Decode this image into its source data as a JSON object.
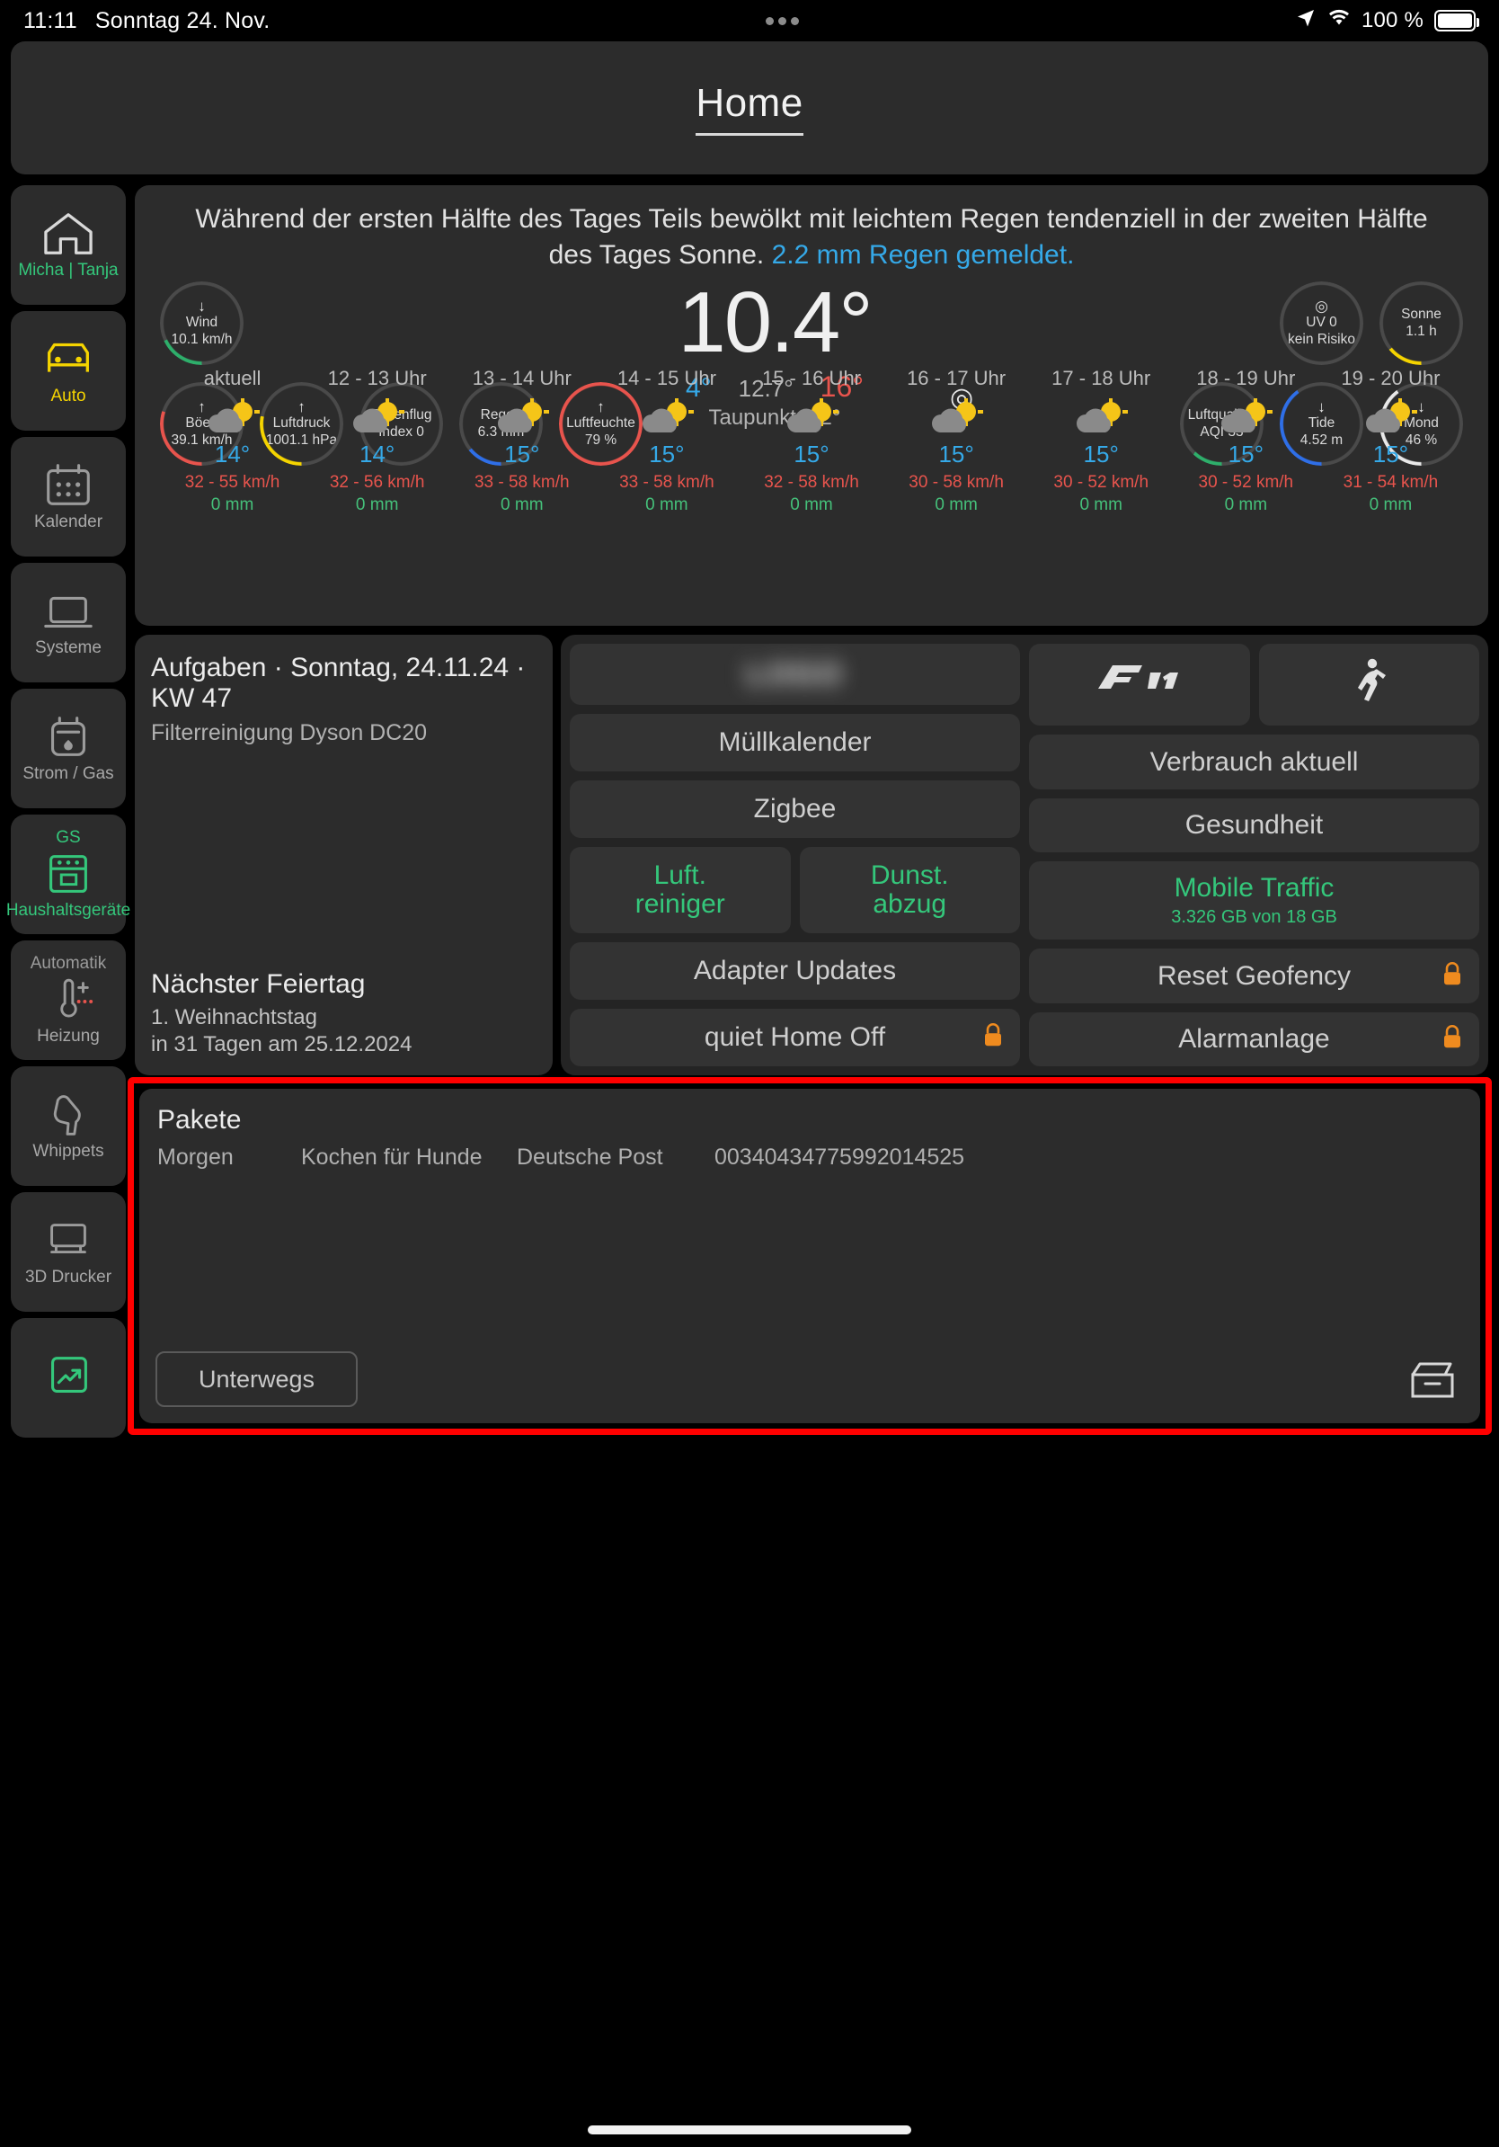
{
  "statusbar": {
    "time": "11:11",
    "date": "Sonntag 24. Nov.",
    "battery_percent": "100 %",
    "location_icon": "location-arrow-icon",
    "wifi_icon": "wifi-icon"
  },
  "header": {
    "title": "Home"
  },
  "sidebar": {
    "items": [
      {
        "label": "Micha | Tanja",
        "icon": "house-icon",
        "state": "green",
        "top": ""
      },
      {
        "label": "Auto",
        "icon": "car-icon",
        "state": "yellow",
        "top": ""
      },
      {
        "label": "Kalender",
        "icon": "calendar-icon",
        "state": "grey",
        "top": ""
      },
      {
        "label": "Systeme",
        "icon": "laptop-icon",
        "state": "grey",
        "top": ""
      },
      {
        "label": "Strom / Gas",
        "icon": "meter-icon",
        "state": "grey",
        "top": ""
      },
      {
        "label": "Haushaltsgeräte",
        "icon": "dishwasher-icon",
        "state": "green",
        "top": "GS"
      },
      {
        "label": "Heizung",
        "icon": "thermostat-icon",
        "state": "grey",
        "top": "Automatik"
      },
      {
        "label": "Whippets",
        "icon": "dog-icon",
        "state": "grey",
        "top": ""
      },
      {
        "label": "3D Drucker",
        "icon": "printer-icon",
        "state": "grey",
        "top": ""
      },
      {
        "label": "",
        "icon": "trend-chart-icon",
        "state": "green",
        "top": ""
      }
    ]
  },
  "weather": {
    "summary_prefix": "Während der ersten Hälfte des Tages Teils bewölkt mit leichtem Regen tendenziell in der zweiten Hälfte des Tages Sonne. ",
    "summary_rain": "2.2 mm Regen gemeldet.",
    "temperature": "10.4°",
    "temp_min": "4°",
    "temp_feels": "12.7°",
    "temp_max": "16°",
    "dewpoint": "Taupunkt 9.2°",
    "target_icon": "target-icon",
    "gauges": [
      {
        "name": "Wind",
        "value": "10.1 km/h",
        "arrow": "↓",
        "color": "#2eaf6b",
        "pct": 18
      },
      {
        "name": "Böen",
        "value": "39.1 km/h",
        "arrow": "↑",
        "color": "#e8544d",
        "pct": 30
      },
      {
        "name": "Luftdruck",
        "value": "1001.1 hPa",
        "arrow": "↑",
        "color": "#f5d400",
        "pct": 28
      },
      {
        "name": "Pollenflug",
        "value": "Index 0",
        "arrow": "",
        "color": "#4a4a4a",
        "pct": 0
      },
      {
        "name": "Regen",
        "value": "6.3 mm",
        "arrow": "",
        "color": "#2f6fe8",
        "pct": 14
      },
      {
        "name": "Luftfeuchte",
        "value": "79 %",
        "arrow": "↑",
        "color": "#e8544d",
        "pct": 79
      },
      {
        "name": "UV 0",
        "value": "kein Risiko",
        "arrow": "",
        "icon": "uv-target-icon",
        "color": "#4a4a4a",
        "pct": 0
      },
      {
        "name": "Sonne",
        "value": "1.1 h",
        "arrow": "",
        "color": "#f5d400",
        "pct": 14
      },
      {
        "name": "Luftqualität",
        "value": "AQI 33",
        "arrow": "",
        "color": "#2eaf6b",
        "pct": 12
      },
      {
        "name": "Tide",
        "value": "4.52 m",
        "arrow": "↓",
        "color": "#2f6fe8",
        "pct": 40
      },
      {
        "name": "Mond",
        "value": "46 %",
        "arrow": "↓",
        "color": "#e9e9e9",
        "pct": 40
      }
    ],
    "hourly": [
      {
        "time": "aktuell",
        "icon": "cloud-sun-icon",
        "temp": "14°",
        "wind": "32 - 55 km/h",
        "rain": "0 mm"
      },
      {
        "time": "12 - 13 Uhr",
        "icon": "cloud-sun-icon",
        "temp": "14°",
        "wind": "32 - 56 km/h",
        "rain": "0 mm"
      },
      {
        "time": "13 - 14 Uhr",
        "icon": "cloud-sun-icon",
        "temp": "15°",
        "wind": "33 - 58 km/h",
        "rain": "0 mm"
      },
      {
        "time": "14 - 15 Uhr",
        "icon": "cloud-sun-icon",
        "temp": "15°",
        "wind": "33 - 58 km/h",
        "rain": "0 mm"
      },
      {
        "time": "15 - 16 Uhr",
        "icon": "cloud-sun-icon",
        "temp": "15°",
        "wind": "32 - 58 km/h",
        "rain": "0 mm"
      },
      {
        "time": "16 - 17 Uhr",
        "icon": "cloud-sun-icon",
        "temp": "15°",
        "wind": "30 - 58 km/h",
        "rain": "0 mm"
      },
      {
        "time": "17 - 18 Uhr",
        "icon": "cloud-sun-icon",
        "temp": "15°",
        "wind": "30 - 52 km/h",
        "rain": "0 mm"
      },
      {
        "time": "18 - 19 Uhr",
        "icon": "cloud-sun-icon",
        "temp": "15°",
        "wind": "30 - 52 km/h",
        "rain": "0 mm"
      },
      {
        "time": "19 - 20 Uhr",
        "icon": "cloud-sun-icon",
        "temp": "15°",
        "wind": "31 - 54 km/h",
        "rain": "0 mm"
      }
    ]
  },
  "tasks": {
    "title": "Aufgaben · Sonntag, 24.11.24 · KW 47",
    "item": "Filterreinigung Dyson DC20",
    "holiday_title": "Nächster Feiertag",
    "holiday_name": "1. Weihnachtstag",
    "holiday_when": "in 31 Tagen am 25.12.2024"
  },
  "buttons": {
    "logo_blur": "LOGO",
    "f1_icon": "f1-logo-icon",
    "bundesliga_icon": "bundesliga-logo-icon",
    "muellkalender": "Müllkalender",
    "verbrauch": "Verbrauch aktuell",
    "zigbee": "Zigbee",
    "gesundheit": "Gesundheit",
    "luftreiniger": "Luft.\nreiniger",
    "luftreiniger_l1": "Luft.",
    "luftreiniger_l2": "reiniger",
    "dunstabzug_l1": "Dunst.",
    "dunstabzug_l2": "abzug",
    "mobile_traffic": "Mobile Traffic",
    "mobile_traffic_sub": "3.326 GB von 18 GB",
    "adapter_updates": "Adapter Updates",
    "reset_geofency": "Reset Geofency",
    "quiet_home_off": "quiet Home Off",
    "alarmanlage": "Alarmanlage",
    "lock_icon": "lock-icon"
  },
  "pakete": {
    "title": "Pakete",
    "columns": [
      "Morgen",
      "Kochen für Hunde",
      "Deutsche Post",
      "00340434775992014525"
    ],
    "status_button": "Unterwegs",
    "parcel_icon": "parcel-icon"
  }
}
